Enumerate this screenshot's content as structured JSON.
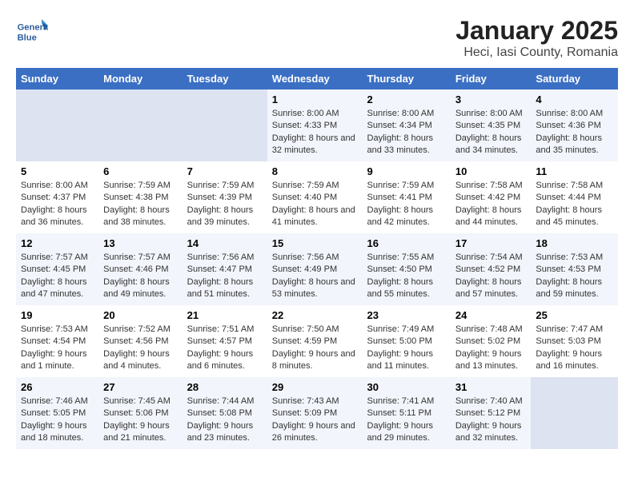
{
  "logo": {
    "line1": "General",
    "line2": "Blue"
  },
  "title": "January 2025",
  "subtitle": "Heci, Iasi County, Romania",
  "weekdays": [
    "Sunday",
    "Monday",
    "Tuesday",
    "Wednesday",
    "Thursday",
    "Friday",
    "Saturday"
  ],
  "weeks": [
    [
      {
        "day": "",
        "sunrise": "",
        "sunset": "",
        "daylight": ""
      },
      {
        "day": "",
        "sunrise": "",
        "sunset": "",
        "daylight": ""
      },
      {
        "day": "",
        "sunrise": "",
        "sunset": "",
        "daylight": ""
      },
      {
        "day": "1",
        "sunrise": "Sunrise: 8:00 AM",
        "sunset": "Sunset: 4:33 PM",
        "daylight": "Daylight: 8 hours and 32 minutes."
      },
      {
        "day": "2",
        "sunrise": "Sunrise: 8:00 AM",
        "sunset": "Sunset: 4:34 PM",
        "daylight": "Daylight: 8 hours and 33 minutes."
      },
      {
        "day": "3",
        "sunrise": "Sunrise: 8:00 AM",
        "sunset": "Sunset: 4:35 PM",
        "daylight": "Daylight: 8 hours and 34 minutes."
      },
      {
        "day": "4",
        "sunrise": "Sunrise: 8:00 AM",
        "sunset": "Sunset: 4:36 PM",
        "daylight": "Daylight: 8 hours and 35 minutes."
      }
    ],
    [
      {
        "day": "5",
        "sunrise": "Sunrise: 8:00 AM",
        "sunset": "Sunset: 4:37 PM",
        "daylight": "Daylight: 8 hours and 36 minutes."
      },
      {
        "day": "6",
        "sunrise": "Sunrise: 7:59 AM",
        "sunset": "Sunset: 4:38 PM",
        "daylight": "Daylight: 8 hours and 38 minutes."
      },
      {
        "day": "7",
        "sunrise": "Sunrise: 7:59 AM",
        "sunset": "Sunset: 4:39 PM",
        "daylight": "Daylight: 8 hours and 39 minutes."
      },
      {
        "day": "8",
        "sunrise": "Sunrise: 7:59 AM",
        "sunset": "Sunset: 4:40 PM",
        "daylight": "Daylight: 8 hours and 41 minutes."
      },
      {
        "day": "9",
        "sunrise": "Sunrise: 7:59 AM",
        "sunset": "Sunset: 4:41 PM",
        "daylight": "Daylight: 8 hours and 42 minutes."
      },
      {
        "day": "10",
        "sunrise": "Sunrise: 7:58 AM",
        "sunset": "Sunset: 4:42 PM",
        "daylight": "Daylight: 8 hours and 44 minutes."
      },
      {
        "day": "11",
        "sunrise": "Sunrise: 7:58 AM",
        "sunset": "Sunset: 4:44 PM",
        "daylight": "Daylight: 8 hours and 45 minutes."
      }
    ],
    [
      {
        "day": "12",
        "sunrise": "Sunrise: 7:57 AM",
        "sunset": "Sunset: 4:45 PM",
        "daylight": "Daylight: 8 hours and 47 minutes."
      },
      {
        "day": "13",
        "sunrise": "Sunrise: 7:57 AM",
        "sunset": "Sunset: 4:46 PM",
        "daylight": "Daylight: 8 hours and 49 minutes."
      },
      {
        "day": "14",
        "sunrise": "Sunrise: 7:56 AM",
        "sunset": "Sunset: 4:47 PM",
        "daylight": "Daylight: 8 hours and 51 minutes."
      },
      {
        "day": "15",
        "sunrise": "Sunrise: 7:56 AM",
        "sunset": "Sunset: 4:49 PM",
        "daylight": "Daylight: 8 hours and 53 minutes."
      },
      {
        "day": "16",
        "sunrise": "Sunrise: 7:55 AM",
        "sunset": "Sunset: 4:50 PM",
        "daylight": "Daylight: 8 hours and 55 minutes."
      },
      {
        "day": "17",
        "sunrise": "Sunrise: 7:54 AM",
        "sunset": "Sunset: 4:52 PM",
        "daylight": "Daylight: 8 hours and 57 minutes."
      },
      {
        "day": "18",
        "sunrise": "Sunrise: 7:53 AM",
        "sunset": "Sunset: 4:53 PM",
        "daylight": "Daylight: 8 hours and 59 minutes."
      }
    ],
    [
      {
        "day": "19",
        "sunrise": "Sunrise: 7:53 AM",
        "sunset": "Sunset: 4:54 PM",
        "daylight": "Daylight: 9 hours and 1 minute."
      },
      {
        "day": "20",
        "sunrise": "Sunrise: 7:52 AM",
        "sunset": "Sunset: 4:56 PM",
        "daylight": "Daylight: 9 hours and 4 minutes."
      },
      {
        "day": "21",
        "sunrise": "Sunrise: 7:51 AM",
        "sunset": "Sunset: 4:57 PM",
        "daylight": "Daylight: 9 hours and 6 minutes."
      },
      {
        "day": "22",
        "sunrise": "Sunrise: 7:50 AM",
        "sunset": "Sunset: 4:59 PM",
        "daylight": "Daylight: 9 hours and 8 minutes."
      },
      {
        "day": "23",
        "sunrise": "Sunrise: 7:49 AM",
        "sunset": "Sunset: 5:00 PM",
        "daylight": "Daylight: 9 hours and 11 minutes."
      },
      {
        "day": "24",
        "sunrise": "Sunrise: 7:48 AM",
        "sunset": "Sunset: 5:02 PM",
        "daylight": "Daylight: 9 hours and 13 minutes."
      },
      {
        "day": "25",
        "sunrise": "Sunrise: 7:47 AM",
        "sunset": "Sunset: 5:03 PM",
        "daylight": "Daylight: 9 hours and 16 minutes."
      }
    ],
    [
      {
        "day": "26",
        "sunrise": "Sunrise: 7:46 AM",
        "sunset": "Sunset: 5:05 PM",
        "daylight": "Daylight: 9 hours and 18 minutes."
      },
      {
        "day": "27",
        "sunrise": "Sunrise: 7:45 AM",
        "sunset": "Sunset: 5:06 PM",
        "daylight": "Daylight: 9 hours and 21 minutes."
      },
      {
        "day": "28",
        "sunrise": "Sunrise: 7:44 AM",
        "sunset": "Sunset: 5:08 PM",
        "daylight": "Daylight: 9 hours and 23 minutes."
      },
      {
        "day": "29",
        "sunrise": "Sunrise: 7:43 AM",
        "sunset": "Sunset: 5:09 PM",
        "daylight": "Daylight: 9 hours and 26 minutes."
      },
      {
        "day": "30",
        "sunrise": "Sunrise: 7:41 AM",
        "sunset": "Sunset: 5:11 PM",
        "daylight": "Daylight: 9 hours and 29 minutes."
      },
      {
        "day": "31",
        "sunrise": "Sunrise: 7:40 AM",
        "sunset": "Sunset: 5:12 PM",
        "daylight": "Daylight: 9 hours and 32 minutes."
      },
      {
        "day": "",
        "sunrise": "",
        "sunset": "",
        "daylight": ""
      }
    ]
  ]
}
